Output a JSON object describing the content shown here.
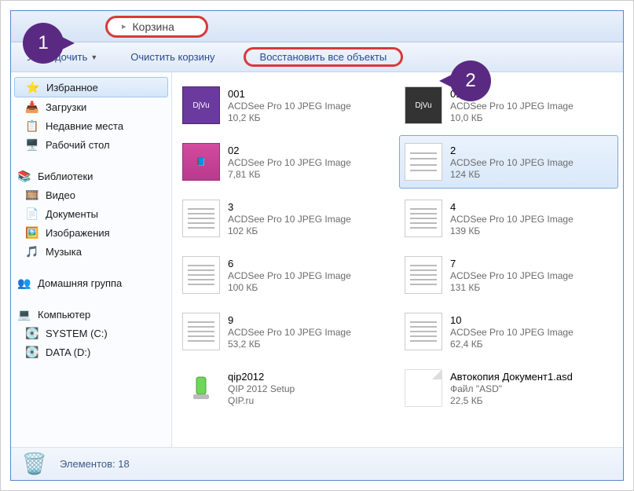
{
  "breadcrumb": {
    "location": "Корзина"
  },
  "toolbar": {
    "organize": "Упорядочить",
    "empty": "Очистить корзину",
    "restore_all": "Восстановить все объекты"
  },
  "sidebar": {
    "favorites": "Избранное",
    "downloads": "Загрузки",
    "recent": "Недавние места",
    "desktop": "Рабочий стол",
    "libraries": "Библиотеки",
    "video": "Видео",
    "documents": "Документы",
    "pictures": "Изображения",
    "music": "Музыка",
    "homegroup": "Домашняя группа",
    "computer": "Компьютер",
    "system_c": "SYSTEM (C:)",
    "data_d": "DATA (D:)"
  },
  "files": [
    {
      "name": "001",
      "type": "ACDSee Pro 10 JPEG Image",
      "size": "10,2 КБ"
    },
    {
      "name": "01",
      "type": "ACDSee Pro 10 JPEG Image",
      "size": "10,0 КБ"
    },
    {
      "name": "02",
      "type": "ACDSee Pro 10 JPEG Image",
      "size": "7,81 КБ"
    },
    {
      "name": "2",
      "type": "ACDSee Pro 10 JPEG Image",
      "size": "124 КБ"
    },
    {
      "name": "3",
      "type": "ACDSee Pro 10 JPEG Image",
      "size": "102 КБ"
    },
    {
      "name": "4",
      "type": "ACDSee Pro 10 JPEG Image",
      "size": "139 КБ"
    },
    {
      "name": "6",
      "type": "ACDSee Pro 10 JPEG Image",
      "size": "100 КБ"
    },
    {
      "name": "7",
      "type": "ACDSee Pro 10 JPEG Image",
      "size": "131 КБ"
    },
    {
      "name": "9",
      "type": "ACDSee Pro 10 JPEG Image",
      "size": "53,2 КБ"
    },
    {
      "name": "10",
      "type": "ACDSee Pro 10 JPEG Image",
      "size": "62,4 КБ"
    },
    {
      "name": "qip2012",
      "type": "QIP 2012 Setup",
      "size": "QIP.ru"
    },
    {
      "name": "Автокопия Документ1.asd",
      "type": "Файл \"ASD\"",
      "size": "22,5 КБ"
    }
  ],
  "status": {
    "label": "Элементов:",
    "count": "18"
  },
  "callouts": {
    "one": "1",
    "two": "2"
  }
}
